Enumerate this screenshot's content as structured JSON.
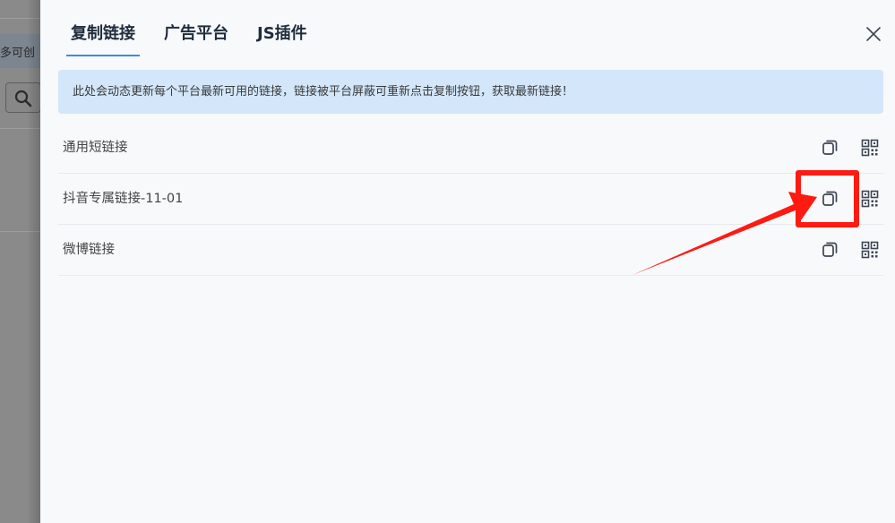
{
  "background": {
    "chip_text": "多可创"
  },
  "tabs": [
    {
      "label": "复制链接",
      "active": true
    },
    {
      "label": "广告平台",
      "active": false
    },
    {
      "label": "JS插件",
      "active": false
    }
  ],
  "notice": "此处会动态更新每个平台最新可用的链接，链接被平台屏蔽可重新点击复制按钮，获取最新链接！",
  "links": [
    {
      "label": "通用短链接"
    },
    {
      "label": "抖音专属链接-11-01"
    },
    {
      "label": "微博链接"
    }
  ],
  "icons": {
    "copy": "copy-icon",
    "qr": "qrcode-icon",
    "close": "close-icon",
    "search": "search-icon"
  },
  "colors": {
    "tab_underline": "#3c8dd9",
    "notice_bg": "#d3e6fa",
    "annotation": "#ff1a12",
    "icon": "#3d4653"
  }
}
